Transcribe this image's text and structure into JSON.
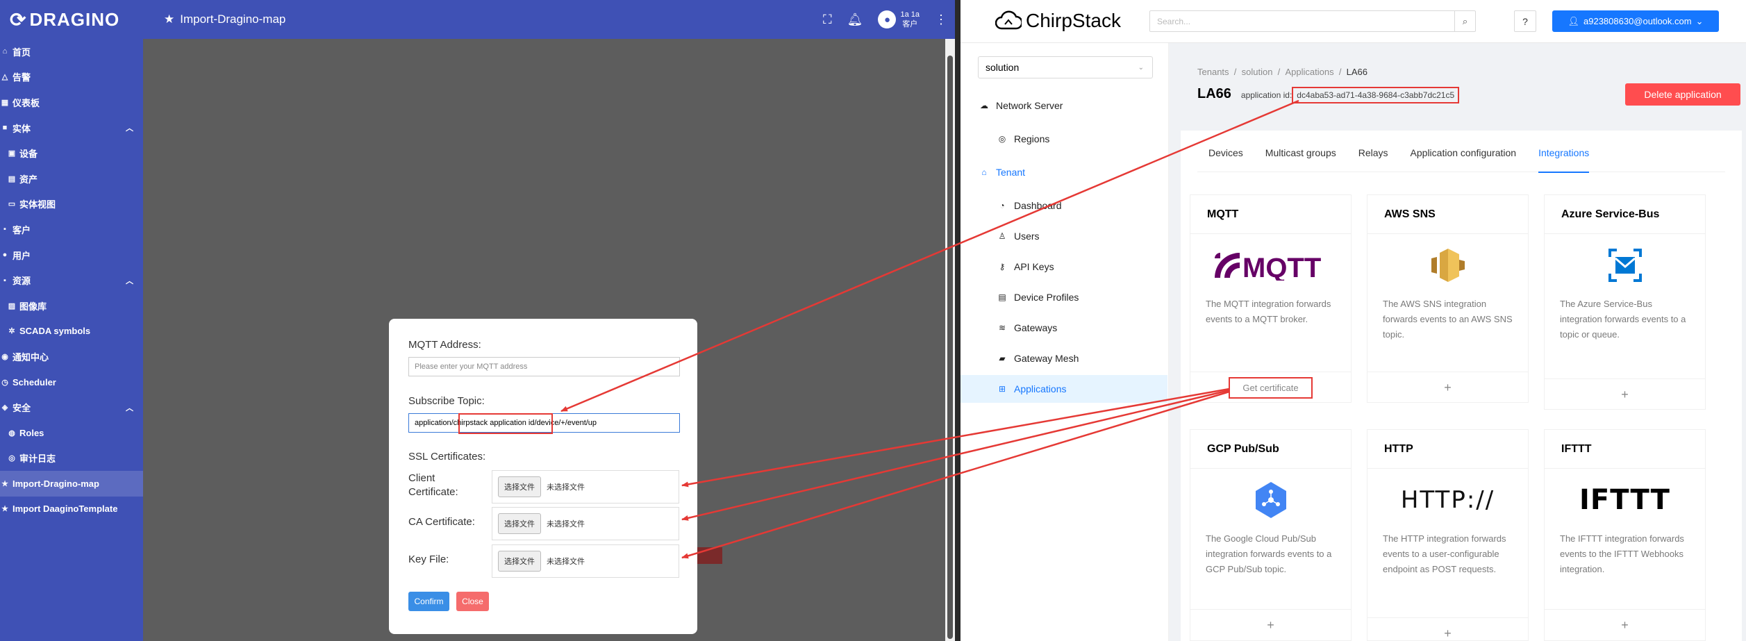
{
  "tb": {
    "logo_text": "DRAGINO",
    "page_title": "Import-Dragino-map",
    "user_name": "1a 1a",
    "user_role": "客户",
    "nav": [
      {
        "label": "首页",
        "icon": "home-icon"
      },
      {
        "label": "告警",
        "icon": "alarm-icon"
      },
      {
        "label": "仪表板",
        "icon": "dashboard-icon"
      },
      {
        "label": "实体",
        "icon": "entity-icon"
      },
      {
        "label": "设备",
        "icon": "device-icon"
      },
      {
        "label": "资产",
        "icon": "asset-icon"
      },
      {
        "label": "实体视图",
        "icon": "entity-view-icon"
      },
      {
        "label": "客户",
        "icon": "customer-icon"
      },
      {
        "label": "用户",
        "icon": "user-icon"
      },
      {
        "label": "资源",
        "icon": "resource-icon"
      },
      {
        "label": "图像库",
        "icon": "image-gallery-icon"
      },
      {
        "label": "SCADA symbols",
        "icon": "scada-icon"
      },
      {
        "label": "通知中心",
        "icon": "notification-icon"
      },
      {
        "label": "Scheduler",
        "icon": "scheduler-icon"
      },
      {
        "label": "安全",
        "icon": "security-icon"
      },
      {
        "label": "Roles",
        "icon": "roles-icon"
      },
      {
        "label": "审计日志",
        "icon": "audit-log-icon"
      },
      {
        "label": "Import-Dragino-map",
        "icon": "star-icon"
      },
      {
        "label": "Import DaaginoTemplate",
        "icon": "star-icon"
      }
    ]
  },
  "dialog": {
    "mqtt_address_label": "MQTT Address:",
    "mqtt_address_placeholder": "Please enter your MQTT address",
    "subscribe_topic_label": "Subscribe Topic:",
    "topic_prefix": "application/",
    "topic_mid": "chirpstack application id",
    "topic_suffix": "/device/+/event/up",
    "ssl_label": "SSL Certificates:",
    "client_cert_label": "Client Certificate:",
    "ca_cert_label": "CA Certificate:",
    "key_file_label": "Key File:",
    "choose_file": "选择文件",
    "no_file": "未选择文件",
    "confirm": "Confirm",
    "close": "Close"
  },
  "cs": {
    "logo_text": "ChirpStack",
    "search_placeholder": "Search...",
    "help": "?",
    "user_email": "a923808630@outlook.com",
    "tenant_select": "solution",
    "nav": {
      "network_server": "Network Server",
      "regions": "Regions",
      "tenant": "Tenant",
      "dashboard": "Dashboard",
      "users": "Users",
      "api_keys": "API Keys",
      "device_profiles": "Device Profiles",
      "gateways": "Gateways",
      "gateway_mesh": "Gateway Mesh",
      "applications": "Applications"
    },
    "breadcrumb": [
      "Tenants",
      "solution",
      "Applications",
      "LA66"
    ],
    "app_title": "LA66",
    "app_id_label": "application id:",
    "app_id": "dc4aba53-ad71-4a38-9684-c3abb7dc21c5",
    "delete_button": "Delete application",
    "tabs": [
      "Devices",
      "Multicast groups",
      "Relays",
      "Application configuration",
      "Integrations"
    ],
    "cards": [
      {
        "title": "MQTT",
        "desc": "The MQTT integration forwards events to a MQTT broker.",
        "action": "Get certificate"
      },
      {
        "title": "AWS SNS",
        "desc": "The AWS SNS integration forwards events to an AWS SNS topic.",
        "action": "+"
      },
      {
        "title": "Azure Service-Bus",
        "desc": "The Azure Service-Bus integration forwards events to a topic or queue.",
        "action": "+"
      },
      {
        "title": "GCP Pub/Sub",
        "desc": "The Google Cloud Pub/Sub integration forwards events to a GCP Pub/Sub topic.",
        "action": "+"
      },
      {
        "title": "HTTP",
        "desc": "The HTTP integration forwards events to a user-configurable endpoint as POST requests.",
        "action": "+"
      },
      {
        "title": "IFTTT",
        "desc": "The IFTTT integration forwards events to the IFTTT Webhooks integration.",
        "action": "+"
      }
    ],
    "logos": {
      "mqtt": "MQTT",
      "http": "HTTP://",
      "ifttt": "IFTTT"
    }
  },
  "colors": {
    "tb_primary": "#3f51b5",
    "cs_primary": "#1677ff",
    "annotation": "#e53935",
    "delete": "#ff4d4f"
  }
}
